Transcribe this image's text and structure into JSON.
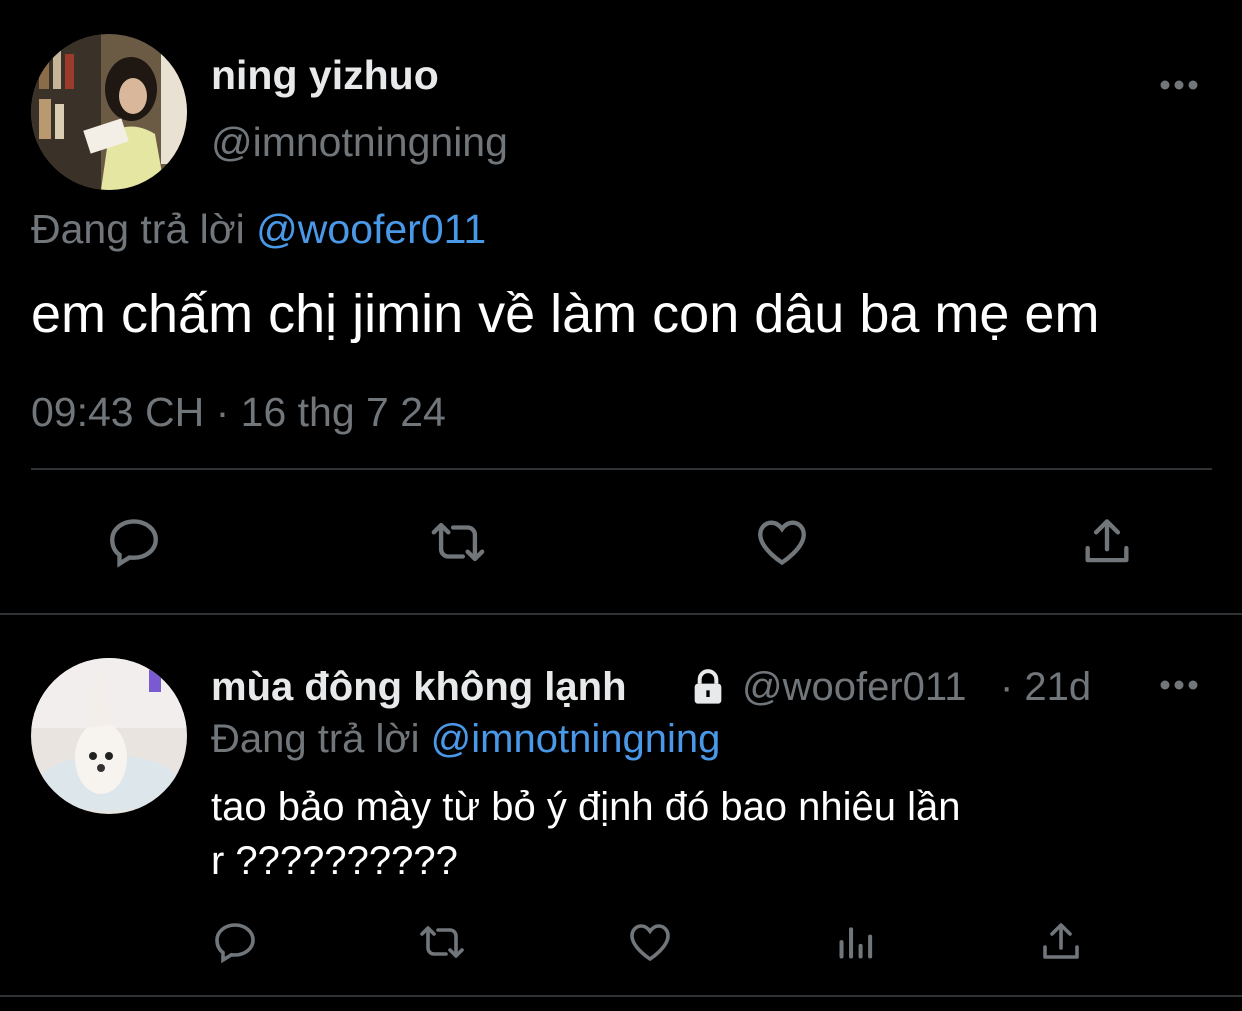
{
  "tweet": {
    "author_name": "ning yizhuo",
    "author_handle": "@imnotningning",
    "reply_prefix": "Đang trả lời",
    "reply_to": "@woofer011",
    "text": "em chấm chị jimin về làm con dâu ba mẹ em",
    "timestamp": "09:43 CH · 16 thg 7 24",
    "avatar_icon": "avatar-photo",
    "actions": [
      "reply-icon",
      "retweet-icon",
      "like-icon",
      "share-icon"
    ]
  },
  "reply": {
    "author_name": "mùa đông không lạnh",
    "author_handle": "@woofer011",
    "age": "· 21d",
    "reply_prefix": "Đang trả lời",
    "reply_to": "@imnotningning",
    "text_line1": "tao bảo mày từ bỏ ý định đó bao nhiêu lần",
    "text_line2": "r ??????????",
    "avatar_icon": "avatar-photo",
    "actions": [
      "reply-icon",
      "retweet-icon",
      "like-icon",
      "views-icon",
      "share-icon"
    ]
  },
  "colors": {
    "background": "#000000",
    "text": "#e7e9ea",
    "muted": "#71767b",
    "link": "#4a99e9",
    "divider": "#2f3336"
  }
}
